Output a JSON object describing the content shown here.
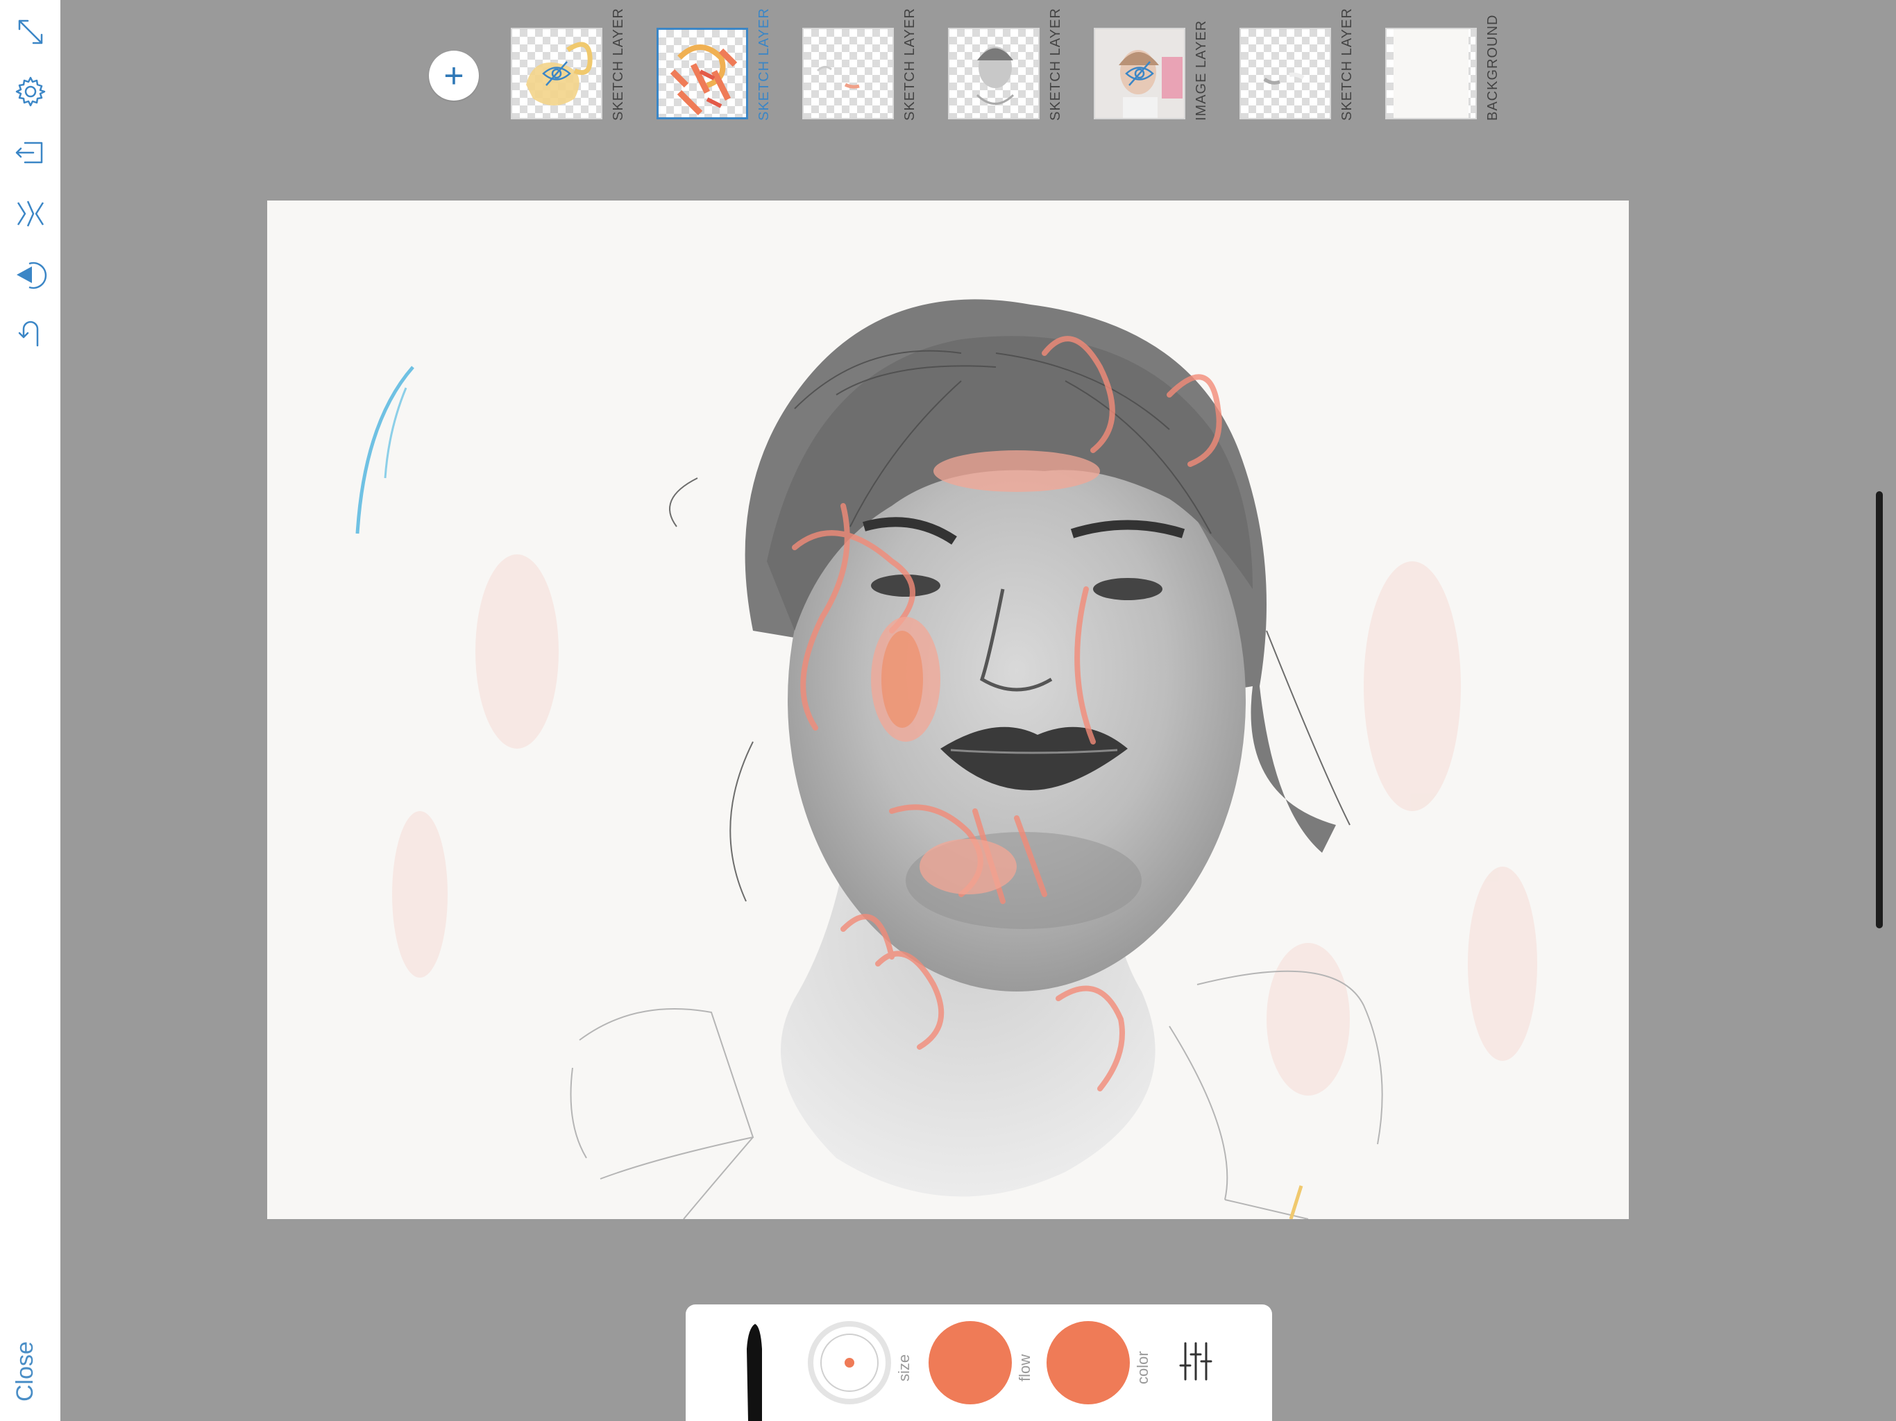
{
  "left_toolbar": {
    "tools": [
      {
        "name": "fit-screen-icon"
      },
      {
        "name": "settings-icon"
      },
      {
        "name": "export-icon"
      },
      {
        "name": "symmetry-icon"
      },
      {
        "name": "fill-icon"
      },
      {
        "name": "undo-icon"
      }
    ],
    "close_label": "Close"
  },
  "layers": {
    "add_icon": "+",
    "items": [
      {
        "label": "SKETCH LAYER",
        "hidden": true,
        "selected": false
      },
      {
        "label": "SKETCH LAYER",
        "hidden": false,
        "selected": true
      },
      {
        "label": "SKETCH LAYER",
        "hidden": false,
        "selected": false
      },
      {
        "label": "SKETCH LAYER",
        "hidden": false,
        "selected": false
      },
      {
        "label": "IMAGE LAYER",
        "hidden": true,
        "selected": false
      },
      {
        "label": "SKETCH LAYER",
        "hidden": false,
        "selected": false
      },
      {
        "label": "BACKGROUND",
        "hidden": false,
        "selected": false
      }
    ]
  },
  "brush": {
    "size_label": "size",
    "flow_label": "flow",
    "color_label": "color",
    "flow_color": "#ef7b57",
    "color": "#ef7b57"
  },
  "colors": {
    "accent": "#3b86c6",
    "brush_color": "#ef7b57",
    "workspace": "#9a9a9a"
  }
}
